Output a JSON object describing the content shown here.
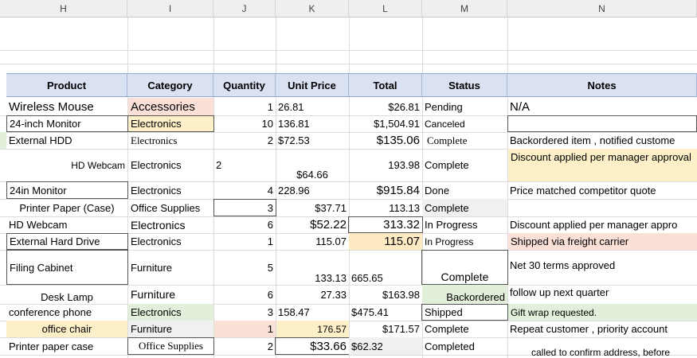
{
  "columns": [
    "H",
    "I",
    "J",
    "K",
    "L",
    "M",
    "N"
  ],
  "headers": {
    "product": "Product",
    "category": "Category",
    "quantity": "Quantity",
    "unit_price": "Unit Price",
    "total": "Total",
    "status": "Status",
    "notes": "Notes"
  },
  "rows": [
    {
      "product": "Wireless Mouse",
      "category": "Accessories",
      "quantity": "1",
      "unit_price": "26.81",
      "total": "$26.81",
      "status": "Pending",
      "notes": "N/A"
    },
    {
      "product": "24-inch Monitor",
      "category": "Electronics",
      "quantity": "10",
      "unit_price": "136.81",
      "total": "$1,504.91",
      "status": "Canceled",
      "notes": ""
    },
    {
      "product": "External HDD",
      "category": "Electronics",
      "quantity": "2",
      "unit_price": "$72.53",
      "total": "$135.06",
      "status": "Complete",
      "notes": "Backordered item , notified custome"
    },
    {
      "product": "HD Webcam",
      "category": "Electronics",
      "quantity": "2",
      "unit_price": "$64.66",
      "total": "193.98",
      "status": "Complete",
      "notes": "Discount applied per manager approval"
    },
    {
      "product": "24in Monitor",
      "category": "Electronics",
      "quantity": "4",
      "unit_price": "228.96",
      "total": "$915.84",
      "status": "Done",
      "notes": "Price matched competitor quote"
    },
    {
      "product": "Printer Paper (Case)",
      "category": "Office Supplies",
      "quantity": "3",
      "unit_price": "$37.71",
      "total": "113.13",
      "status": "Complete",
      "notes": ""
    },
    {
      "product": "HD Webcam",
      "category": "Electronics",
      "quantity": "6",
      "unit_price": "$52.22",
      "total": "313.32",
      "status": "In Progress",
      "notes": "Discount applied per manager appro"
    },
    {
      "product": "External Hard Drive",
      "category": "Electronics",
      "quantity": "1",
      "unit_price": "115.07",
      "total": "115.07",
      "status": "In Progress",
      "notes": "Shipped via freight carrier"
    },
    {
      "product": "Filing Cabinet",
      "category": "Furniture",
      "quantity": "5",
      "unit_price": "133.13",
      "total": "665.65",
      "status": "Complete",
      "notes": "Net 30 terms approved"
    },
    {
      "product": "Desk Lamp",
      "category": "Furniture",
      "quantity": "6",
      "unit_price": "27.33",
      "total": "$163.98",
      "status": "Backordered",
      "notes": "follow up next quarter"
    },
    {
      "product": "conference  phone",
      "category": "Electronics",
      "quantity": "3",
      "unit_price": "158.47",
      "total": "$475.41",
      "status": "Shipped",
      "notes": "Gift wrap requested."
    },
    {
      "product": "office chair",
      "category": "Furniture",
      "quantity": "1",
      "unit_price": "176.57",
      "total": "$171.57",
      "status": "Complete",
      "notes": "Repeat customer , priority account"
    },
    {
      "product": "Printer  paper case",
      "category": "Office Supplies",
      "quantity": "2",
      "unit_price": "$33.66",
      "total": "$62.32",
      "status": "Completed",
      "notes": "called to confirm address, before"
    }
  ],
  "colors": {
    "header_fill": "#d9e1f2",
    "pink": "#fbe0d8",
    "yellow": "#fdf0c8",
    "green": "#e2efda",
    "gray": "#f0f0f0",
    "orange": "#fde9c2"
  }
}
